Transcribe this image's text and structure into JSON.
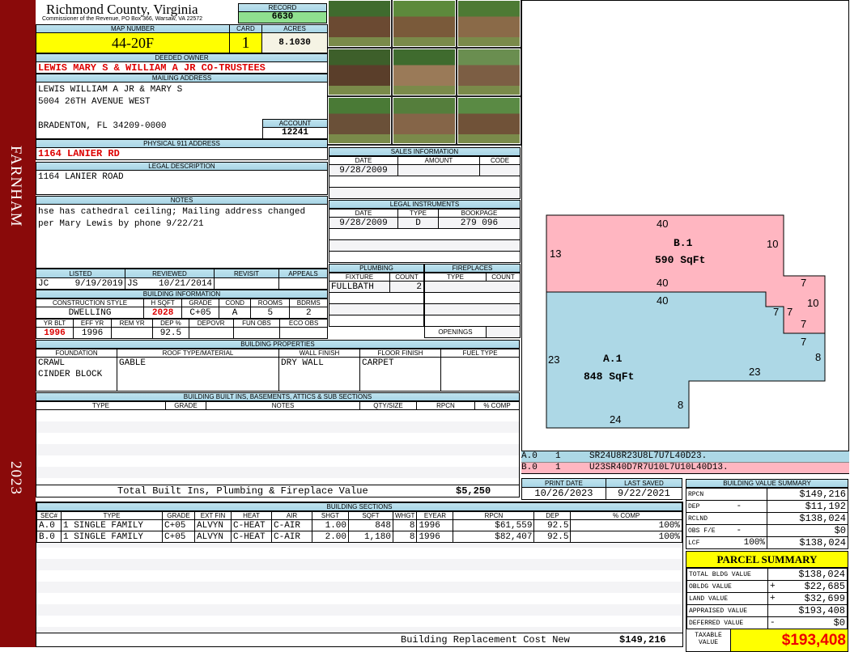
{
  "sidebar": {
    "district": "FARNHAM",
    "year": "2023"
  },
  "header": {
    "county": "Richmond County, Virginia",
    "office": "Commissioner of the Revenue, PO Box 366, Warsaw, VA 22572",
    "record_label": "RECORD",
    "record": "6630"
  },
  "parcel": {
    "map_label": "MAP NUMBER",
    "map_number": "44-20F",
    "card_label": "CARD",
    "card": "1",
    "acres_label": "ACRES",
    "acres": "8.1030"
  },
  "owner": {
    "label": "DEEDED OWNER",
    "value": "LEWIS MARY S & WILLIAM A JR CO-TRUSTEES"
  },
  "mailing": {
    "label": "MAILING ADDRESS",
    "line1": "LEWIS WILLIAM A JR & MARY S",
    "line2": "5004 26TH AVENUE WEST",
    "line3": "BRADENTON, FL 34209-0000",
    "account_label": "ACCOUNT",
    "account": "12241"
  },
  "physical": {
    "label": "PHYSICAL 911 ADDRESS",
    "value": "1164 LANIER RD"
  },
  "legal": {
    "label": "LEGAL DESCRIPTION",
    "value": "1164 LANIER ROAD"
  },
  "notes": {
    "label": "NOTES",
    "value": "hse has cathedral ceiling; Mailing address changed per Mary Lewis by phone 9/22/21"
  },
  "review": {
    "listed_label": "LISTED",
    "reviewed_label": "REVIEWED",
    "revisit_label": "REVISIT",
    "appeals_label": "APPEALS",
    "listed_by": "JC",
    "listed_date": "9/19/2019",
    "reviewed_by": "JS",
    "reviewed_date": "10/21/2014"
  },
  "building_info": {
    "label": "BUILDING INFORMATION",
    "h1": [
      "CONSTRUCTION STYLE",
      "H SQFT",
      "GRADE",
      "COND",
      "ROOMS",
      "BDRMS"
    ],
    "v1": [
      "DWELLING",
      "2028",
      "C+05",
      "A",
      "5",
      "2"
    ],
    "h2": [
      "YR BLT",
      "EFF YR",
      "REM YR",
      "DEP %",
      "DEPOVR",
      "FUN OBS",
      "ECO OBS"
    ],
    "v2": [
      "1996",
      "1996",
      "",
      "92.5",
      "",
      "",
      ""
    ]
  },
  "properties": {
    "label": "BUILDING PROPERTIES",
    "headers": [
      "FOUNDATION",
      "ROOF TYPE/MATERIAL",
      "WALL FINISH",
      "FLOOR FINISH",
      "FUEL TYPE"
    ],
    "foundation1": "CRAWL",
    "foundation2": "CINDER BLOCK",
    "roof": "GABLE",
    "wall": "DRY WALL",
    "floor": "CARPET"
  },
  "builtins": {
    "label": "BUILDING BUILT INS, BASEMENTS, ATTICS & SUB SECTIONS",
    "headers": [
      "TYPE",
      "GRADE",
      "NOTES",
      "QTY/SIZE",
      "RPCN",
      "% COMP"
    ],
    "total_label": "Total Built Ins, Plumbing & Fireplace Value",
    "total": "$5,250"
  },
  "sales": {
    "label": "SALES INFORMATION",
    "headers": [
      "DATE",
      "AMOUNT",
      "CODE"
    ],
    "rows": [
      [
        "9/28/2009",
        "",
        ""
      ]
    ]
  },
  "instruments": {
    "label": "LEGAL INSTRUMENTS",
    "headers": [
      "DATE",
      "TYPE",
      "BOOKPAGE"
    ],
    "rows": [
      [
        "9/28/2009",
        "D",
        "279 096"
      ]
    ]
  },
  "plumbing": {
    "label": "PLUMBING",
    "headers": [
      "FIXTURE",
      "COUNT"
    ],
    "rows": [
      [
        "FULLBATH",
        "2"
      ]
    ]
  },
  "fireplaces": {
    "label": "FIREPLACES",
    "headers": [
      "TYPE",
      "COUNT"
    ],
    "openings": "OPENINGS"
  },
  "sketch": {
    "labels": {
      "b_name": "B.1",
      "b_area": "590 SqFt",
      "a_name": "A.1",
      "a_area": "848 SqFt",
      "d1": "40",
      "d2": "10",
      "d3": "13",
      "d4": "40",
      "d5": "7",
      "d6": "10",
      "d7": "40",
      "d8": "7",
      "d9": "7",
      "d10": "7",
      "d11": "7",
      "d12": "8",
      "d13": "23",
      "d14": "23",
      "d15": "8",
      "d16": "24"
    },
    "codes": [
      {
        "sec": "A.0",
        "n": "1",
        "path": "SR24U8R23U8L7U7L40D23.",
        "color": "#add8e6"
      },
      {
        "sec": "B.0",
        "n": "1",
        "path": "U23SR40D7R7U10L7U10L40D13.",
        "color": "#ffb6c1"
      }
    ]
  },
  "dates": {
    "print_label": "PRINT DATE",
    "print": "10/26/2023",
    "saved_label": "LAST SAVED",
    "saved": "9/22/2021"
  },
  "sections": {
    "label": "BUILDING SECTIONS",
    "headers": [
      "SEC#",
      "TYPE",
      "GRADE",
      "EXT FIN",
      "HEAT",
      "AIR",
      "SHGT",
      "SQFT",
      "WHGT",
      "EYEAR",
      "RPCN",
      "DEP",
      "% COMP"
    ],
    "rows": [
      [
        "A.0",
        "1 SINGLE FAMILY",
        "C+05",
        "ALVYN",
        "C-HEAT",
        "C-AIR",
        "1.00",
        "848",
        "8",
        "1996",
        "$61,559",
        "92.5",
        "100%"
      ],
      [
        "B.0",
        "1 SINGLE FAMILY",
        "C+05",
        "ALVYN",
        "C-HEAT",
        "C-AIR",
        "2.00",
        "1,180",
        "8",
        "1996",
        "$82,407",
        "92.5",
        "100%"
      ]
    ],
    "total_label": "Building Replacement Cost New",
    "total": "$149,216"
  },
  "value_summary": {
    "label": "BUILDING VALUE SUMMARY",
    "rows": [
      [
        "RPCN",
        "",
        "$149,216"
      ],
      [
        "DEP",
        "-",
        "$11,192"
      ],
      [
        "RCLND",
        "",
        "$138,024"
      ],
      [
        "OBS F/E",
        "-",
        "$0"
      ],
      [
        "LCF",
        "100%",
        "$138,024"
      ]
    ]
  },
  "parcel_summary": {
    "label": "PARCEL SUMMARY",
    "rows": [
      [
        "TOTAL BLDG VALUE",
        "",
        "$138,024"
      ],
      [
        "OBLDG VALUE",
        "+",
        "$22,685"
      ],
      [
        "LAND VALUE",
        "+",
        "$32,699"
      ],
      [
        "APPRAISED VALUE",
        "",
        "$193,408"
      ],
      [
        "DEFERRED VALUE",
        "-",
        "$0"
      ]
    ],
    "taxable_label": "TAXABLE VALUE",
    "taxable": "$193,408"
  }
}
